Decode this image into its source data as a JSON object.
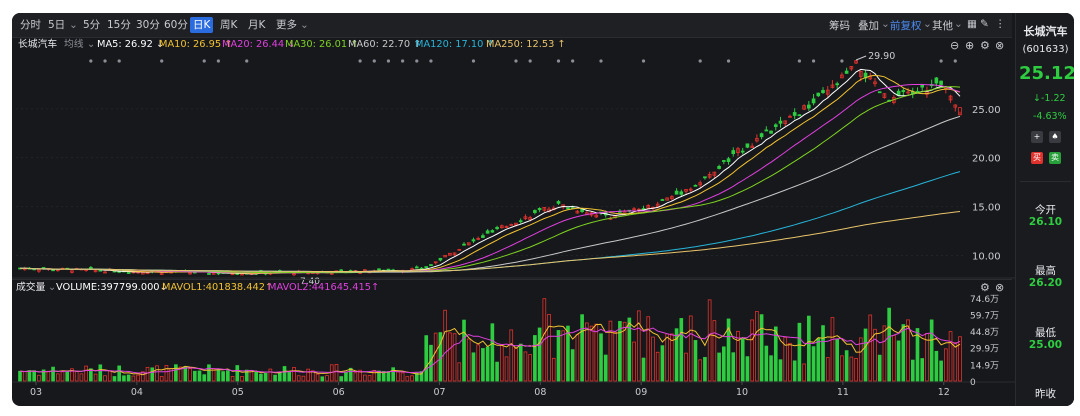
{
  "toolbar": {
    "periods": [
      "分时",
      "5日",
      "5分",
      "15分",
      "30分",
      "60分",
      "日K",
      "周K",
      "月K",
      "更多"
    ],
    "active": "日K",
    "right": {
      "chip": "筹码",
      "overlay": "叠加",
      "adjust": "前复权",
      "other": "其他"
    }
  },
  "ma_line": {
    "stock": "长城汽车",
    "avg_label": "均线",
    "ma5": "MA5: 26.92 ↓",
    "ma10": "MA10: 26.95 ↑",
    "ma20": "MA20: 26.44 ↓",
    "ma30": "MA30: 26.01 ↑",
    "ma60": "MA60: 22.70 ↑",
    "ma120": "MA120: 17.10 ↑",
    "ma250": "MA250: 12.53 ↑"
  },
  "volume_line": {
    "label": "成交量",
    "volume": "VOLUME:397799.000↓",
    "mavol1": "MAVOL1:401838.442↑",
    "mavol2": "MAVOL2:441645.415↑"
  },
  "colors": {
    "up": "#e0322d",
    "down": "#2ecc40",
    "ma5": "#ffffff",
    "ma10": "#f2c230",
    "ma20": "#e040e0",
    "ma30": "#7ed321",
    "ma60": "#c8c8c8",
    "ma120": "#26b5d9",
    "ma250": "#e8c36a",
    "accent": "#2a6be0"
  },
  "chart_data": {
    "type": "candlestick",
    "price_axis": {
      "ticks": [
        "25.00",
        "20.00",
        "15.00",
        "10.00"
      ],
      "values": [
        25,
        20,
        15,
        10
      ],
      "range": [
        7.9,
        30.5
      ]
    },
    "volume_axis": {
      "ticks": [
        "74.6万",
        "59.7万",
        "44.8万",
        "29.9万",
        "14.9万",
        "0"
      ],
      "values": [
        74.6,
        59.7,
        44.8,
        29.9,
        14.9,
        0
      ],
      "unit": "万"
    },
    "months": [
      "03",
      "04",
      "05",
      "06",
      "07",
      "08",
      "09",
      "10",
      "11",
      "12"
    ],
    "annotations": {
      "high_label": "29.90",
      "low_label": "7.40"
    },
    "price_anchors": [
      {
        "month_pos": 0.0,
        "close": 8.7
      },
      {
        "month_pos": 1.0,
        "close": 8.4
      },
      {
        "month_pos": 2.0,
        "close": 8.2
      },
      {
        "month_pos": 3.0,
        "close": 8.3
      },
      {
        "month_pos": 3.9,
        "close": 8.6
      },
      {
        "month_pos": 4.3,
        "close": 11.0
      },
      {
        "month_pos": 4.8,
        "close": 13.5
      },
      {
        "month_pos": 5.2,
        "close": 15.2
      },
      {
        "month_pos": 5.7,
        "close": 14.0
      },
      {
        "month_pos": 6.1,
        "close": 15.0
      },
      {
        "month_pos": 6.6,
        "close": 17.5
      },
      {
        "month_pos": 7.0,
        "close": 21.0
      },
      {
        "month_pos": 7.4,
        "close": 23.5
      },
      {
        "month_pos": 7.8,
        "close": 26.5
      },
      {
        "month_pos": 8.1,
        "close": 29.5
      },
      {
        "month_pos": 8.4,
        "close": 25.8
      },
      {
        "month_pos": 8.9,
        "close": 27.5
      },
      {
        "month_pos": 9.1,
        "close": 25.12
      }
    ],
    "ma_last": {
      "MA5": 26.92,
      "MA10": 26.95,
      "MA20": 26.44,
      "MA30": 26.01,
      "MA60": 22.7,
      "MA120": 17.1,
      "MA250": 12.53
    },
    "volume_last": 39.78
  },
  "side": {
    "name": "长城汽车",
    "code": "(601633)",
    "price": "25.12",
    "change": "-1.22",
    "pct": "-4.63%",
    "buy": "买",
    "sell": "卖",
    "open_label": "今开",
    "open_val": "26.10",
    "high_label": "最高",
    "high_val": "26.20",
    "low_label": "最低",
    "low_val": "25.00",
    "prev_label": "昨收"
  }
}
